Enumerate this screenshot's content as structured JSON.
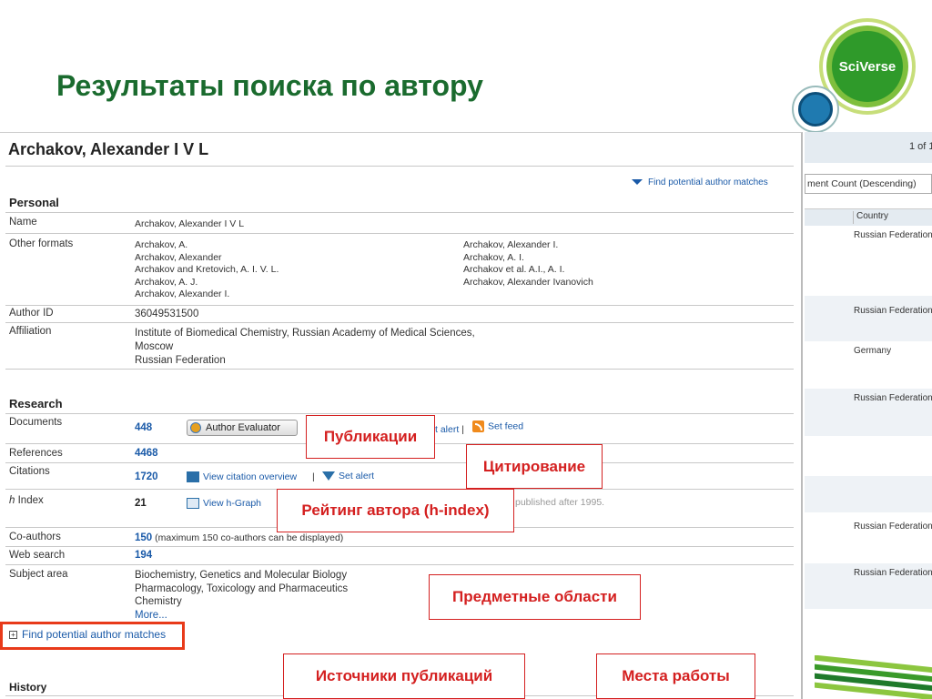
{
  "slide": {
    "title": "Результаты поиска по автору"
  },
  "logo": {
    "text": "SciVerse"
  },
  "author": {
    "name": "Archakov, Alexander I V L"
  },
  "find_top": "Find potential author matches",
  "personal": {
    "heading": "Personal",
    "name_label": "Name",
    "name_value": "Archakov, Alexander I V L",
    "other_formats_label": "Other formats",
    "other_formats_col1": [
      "Archakov, A.",
      "Archakov, Alexander",
      "Archakov and Kretovich, A. I. V. L.",
      "Archakov, A. J.",
      "Archakov, Alexander I."
    ],
    "other_formats_col2": [
      "Archakov, Alexander I.",
      "Archakov, A. I.",
      "Archakov et al. A.I., A. I.",
      "Archakov, Alexander Ivanovich"
    ],
    "author_id_label": "Author ID",
    "author_id_value": "36049531500",
    "affiliation_label": "Affiliation",
    "affiliation_lines": [
      "Institute of Biomedical Chemistry, Russian Academy of Medical Sciences,",
      "Moscow",
      "Russian Federation"
    ]
  },
  "research": {
    "heading": "Research",
    "documents_label": "Documents",
    "documents_value": "448",
    "author_evaluator": "Author Evaluator",
    "set_alert_partial": "t alert",
    "separator": "|",
    "set_feed": "Set feed",
    "references_label": "References",
    "references_value": "4468",
    "citations_label": "Citations",
    "citations_value": "1720",
    "view_citation_overview": "View citation overview",
    "set_alert": "Set alert",
    "hindex_label_italic": "h",
    "hindex_label_rest": " Index",
    "hindex_value": "21",
    "view_hgraph": "View h-Graph",
    "published_after": "published after 1995.",
    "coauthors_label": "Co-authors",
    "coauthors_value": "150",
    "coauthors_note": "(maximum 150 co-authors can be displayed)",
    "websearch_label": "Web search",
    "websearch_value": "194",
    "subject_label": "Subject area",
    "subject_lines": [
      "Biochemistry, Genetics and Molecular Biology",
      "Pharmacology, Toxicology and Pharmaceutics",
      "Chemistry",
      "More..."
    ]
  },
  "find_bottom": "Find potential author matches",
  "history": {
    "heading": "History"
  },
  "right_table": {
    "page_info": "1 of 1",
    "sort_value": "ment Count (Descending)",
    "col_country": "Country",
    "rows": [
      "Russian Federation",
      "Russian Federation",
      "Germany",
      "Russian Federation",
      "Russian Federation",
      "Russian Federation"
    ]
  },
  "annotations": {
    "publications": "Публикации",
    "citations": "Цитирование",
    "hindex": "Рейтинг автора (h-index)",
    "subjects": "Предметные области",
    "sources": "Источники публикаций",
    "workplaces": "Места работы"
  }
}
